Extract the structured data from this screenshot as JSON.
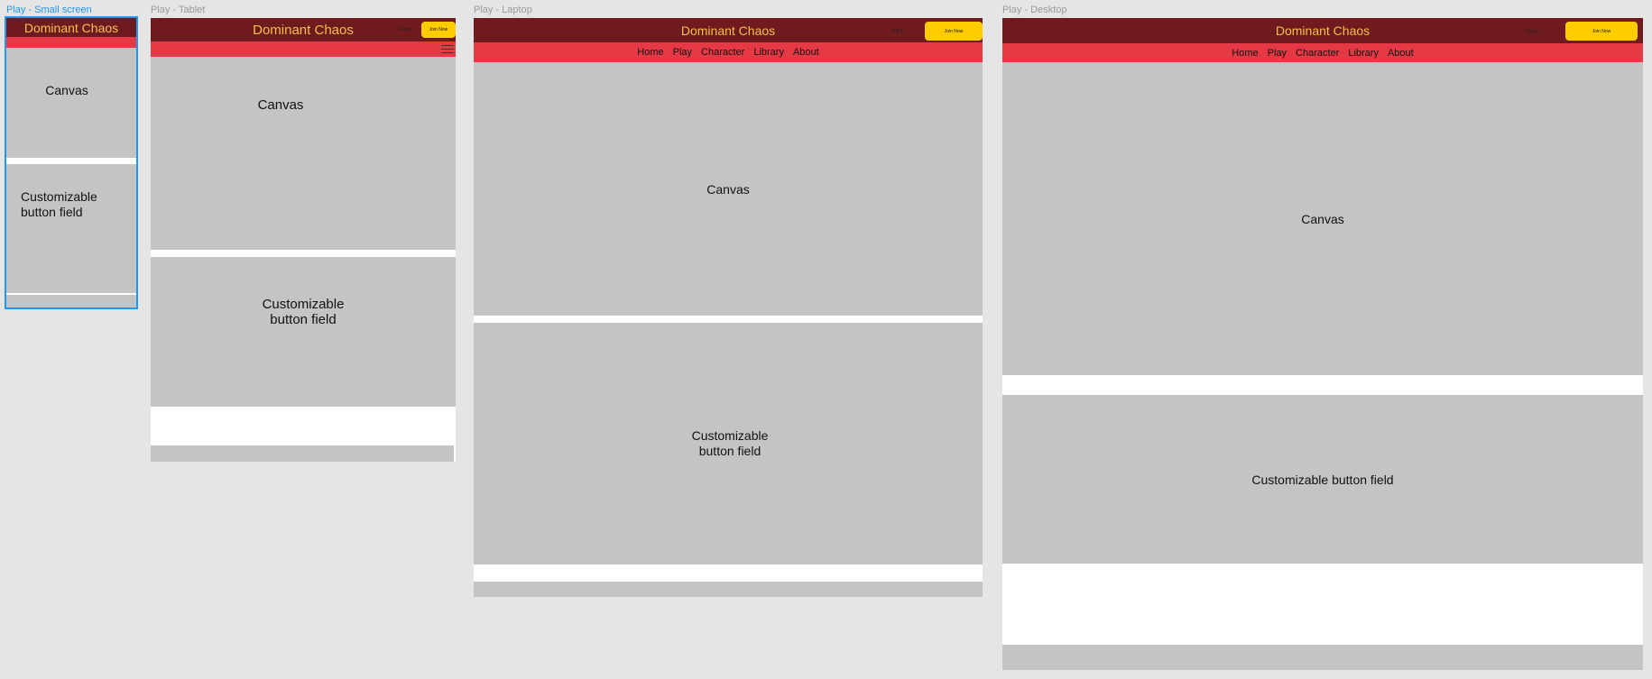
{
  "site_title": "Dominant Chaos",
  "login_label": "Log in",
  "join_label": "Join Now",
  "canvas_label": "Canvas",
  "button_field_label": "Customizable button field",
  "button_field_line1": "Customizable",
  "button_field_line2": "button field",
  "nav_items": [
    "Home",
    "Play",
    "Character",
    "Library",
    "About"
  ],
  "frames": {
    "small": "Play - Small screen",
    "tablet": "Play - Tablet",
    "laptop": "Play - Laptop",
    "desktop": "Play - Desktop"
  },
  "colors": {
    "header_bg": "#6e1a1f",
    "title_text": "#f5c14a",
    "nav_bg": "#e63946",
    "join_button": "#ffcc00",
    "placeholder_gray": "#c4c4c4",
    "selection_blue": "#2196f3"
  }
}
